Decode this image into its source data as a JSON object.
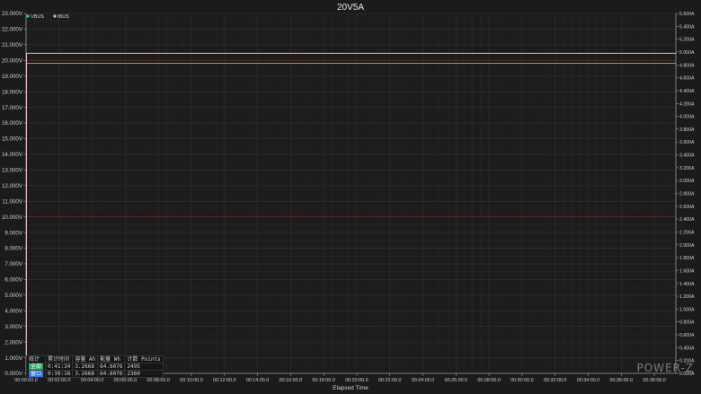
{
  "chart_data": {
    "type": "line",
    "title": "20V5A",
    "xlabel": "Elapsed Time",
    "x_ticks": [
      "00:00:00.0",
      "00:02:00.0",
      "00:04:00.0",
      "00:06:00.0",
      "00:08:00.0",
      "00:10:00.0",
      "00:12:00.0",
      "00:14:00.0",
      "00:16:00.0",
      "00:18:00.0",
      "00:20:00.0",
      "00:22:00.0",
      "00:24:00.0",
      "00:26:00.0",
      "00:28:00.0",
      "00:30:00.0",
      "00:32:00.0",
      "00:34:00.0",
      "00:36:00.0",
      "00:38:00.0"
    ],
    "x_range_min": [
      0,
      39.3
    ],
    "y_left": {
      "range": [
        0,
        23
      ],
      "step": 1,
      "ticks": [
        "0.000V",
        "1.000V",
        "2.000V",
        "3.000V",
        "4.000V",
        "5.000V",
        "6.000V",
        "7.000V",
        "8.000V",
        "9.000V",
        "10.000V",
        "11.000V",
        "12.000V",
        "13.000V",
        "14.000V",
        "15.000V",
        "16.000V",
        "17.000V",
        "18.000V",
        "19.000V",
        "20.000V",
        "21.000V",
        "22.000V",
        "23.000V"
      ]
    },
    "y_right": {
      "range": [
        0,
        5.6
      ],
      "step": 0.2,
      "ticks": [
        "0.000A",
        "0.200A",
        "0.400A",
        "0.600A",
        "0.800A",
        "1.000A",
        "1.200A",
        "1.400A",
        "1.600A",
        "1.800A",
        "2.000A",
        "2.200A",
        "2.400A",
        "2.600A",
        "2.800A",
        "3.000A",
        "3.200A",
        "3.400A",
        "3.600A",
        "3.800A",
        "4.000A",
        "4.200A",
        "4.400A",
        "4.600A",
        "4.800A",
        "5.000A",
        "5.200A",
        "5.400A",
        "5.600A"
      ]
    },
    "series": [
      {
        "name": "VBUS",
        "axis": "left",
        "color": "#2ecc71",
        "x": [
          0,
          0.02,
          0.03,
          39.3
        ],
        "y": [
          0,
          0,
          19.82,
          19.82
        ]
      },
      {
        "name": "IBUS",
        "axis": "right",
        "color": "#e8b4c8",
        "x": [
          0,
          0.02,
          0.03,
          39.3
        ],
        "y": [
          0,
          0,
          4.98,
          4.98
        ]
      }
    ],
    "legend_position": "top-left",
    "grid": true
  },
  "stats": {
    "header": [
      "统计",
      "累计时间",
      "容量 Ah",
      "能量 Wh",
      "计数 Points"
    ],
    "rows": [
      {
        "label": "全部",
        "time": "0:41:34",
        "ah": "3.2668",
        "wh": "64.6076",
        "points": "2495"
      },
      {
        "label": "窗口",
        "time": "0:39:18",
        "ah": "3.2668",
        "wh": "64.6076",
        "points": "2360"
      }
    ]
  },
  "brand": "POWER-Z",
  "colors": {
    "bg": "#1b1b1b",
    "grid_major": "#6b1e1e",
    "grid_minor": "#332626",
    "text": "#d8d8d8"
  }
}
